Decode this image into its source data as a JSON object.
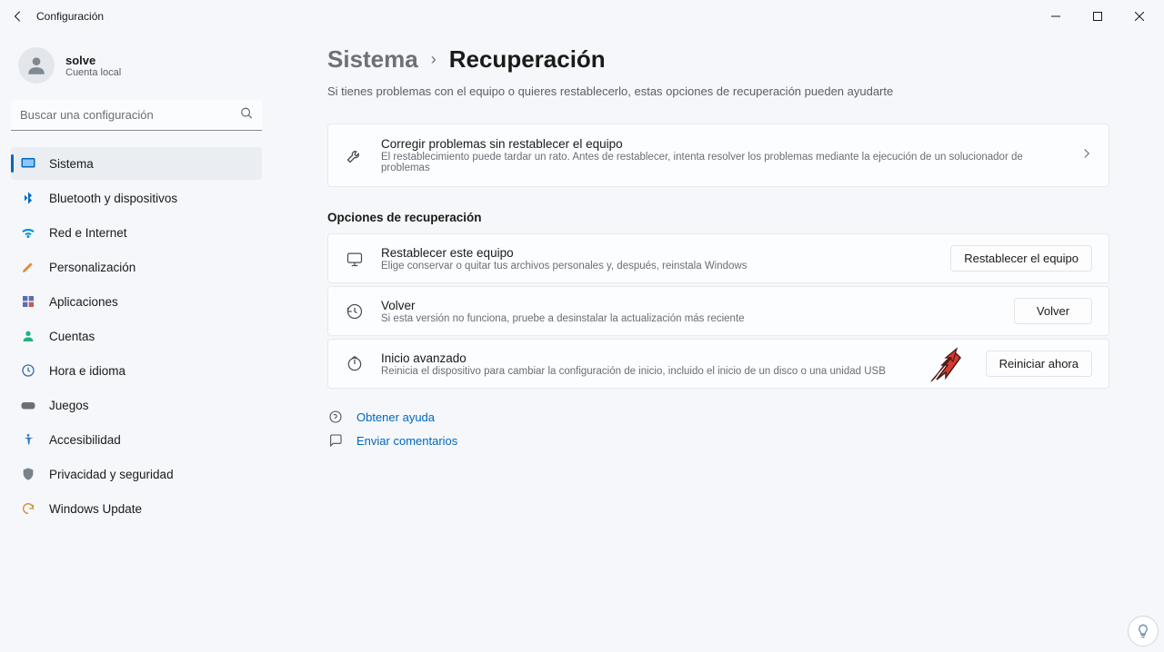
{
  "title": "Configuración",
  "user": {
    "name": "solve",
    "subtitle": "Cuenta local"
  },
  "search": {
    "placeholder": "Buscar una configuración"
  },
  "nav": {
    "items": [
      {
        "label": "Sistema"
      },
      {
        "label": "Bluetooth y dispositivos"
      },
      {
        "label": "Red e Internet"
      },
      {
        "label": "Personalización"
      },
      {
        "label": "Aplicaciones"
      },
      {
        "label": "Cuentas"
      },
      {
        "label": "Hora e idioma"
      },
      {
        "label": "Juegos"
      },
      {
        "label": "Accesibilidad"
      },
      {
        "label": "Privacidad y seguridad"
      },
      {
        "label": "Windows Update"
      }
    ]
  },
  "breadcrumb": {
    "parent": "Sistema",
    "current": "Recuperación"
  },
  "subtitle": "Si tienes problemas con el equipo o quieres restablecerlo, estas opciones de recuperación pueden ayudarte",
  "fix_card": {
    "title": "Corregir problemas sin restablecer el equipo",
    "desc": "El restablecimiento puede tardar un rato. Antes de restablecer, intenta resolver los problemas mediante la ejecución de un solucionador de problemas"
  },
  "section_title": "Opciones de recuperación",
  "options": [
    {
      "title": "Restablecer este equipo",
      "desc": "Elige conservar o quitar tus archivos personales y, después, reinstala Windows",
      "button": "Restablecer el equipo"
    },
    {
      "title": "Volver",
      "desc": "Si esta versión no funciona, pruebe a desinstalar la actualización más reciente",
      "button": "Volver"
    },
    {
      "title": "Inicio avanzado",
      "desc": "Reinicia el dispositivo para cambiar la configuración de inicio, incluido el inicio de un disco o una unidad USB",
      "button": "Reiniciar ahora"
    }
  ],
  "help": {
    "get": "Obtener ayuda",
    "feedback": "Enviar comentarios"
  }
}
